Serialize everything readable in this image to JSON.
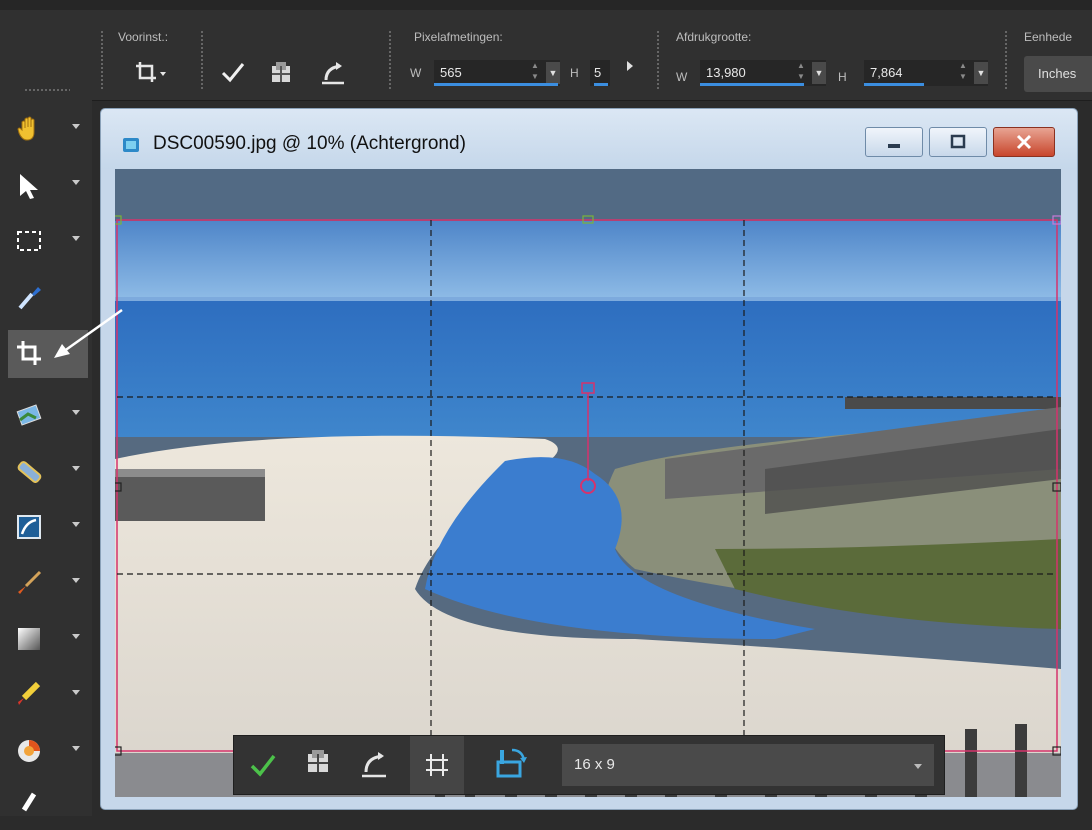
{
  "toolbar": {
    "presets_label": "Voorinst.:",
    "pixel_label": "Pixelafmetingen:",
    "pixel_w_label": "W",
    "pixel_w_value": "565",
    "pixel_h_label": "H",
    "pixel_h_value": "5",
    "print_label": "Afdrukgrootte:",
    "print_w_label": "W",
    "print_w_value": "13,980",
    "print_h_label": "H",
    "print_h_value": "7,864",
    "units_label": "Eenhede",
    "units_value": "Inches"
  },
  "palette": {
    "tools": [
      "pan-tool-icon",
      "pick-tool-icon",
      "selection-tool-icon",
      "dropper-tool-icon",
      "crop-tool-icon",
      "straighten-tool-icon",
      "red-eye-tool-icon",
      "makeover-tool-icon",
      "paint-brush-tool-icon",
      "gradient-tool-icon",
      "eraser-tool-icon",
      "picture-tube-tool-icon"
    ],
    "active_tool": "crop-tool-icon"
  },
  "window": {
    "title": "DSC00590.jpg @  10% (Achtergrond)"
  },
  "croptoolbar": {
    "ratio_value": "16 x 9"
  },
  "colors": {
    "accent": "#3b8ee0",
    "crop_border": "#d6336c",
    "check_green": "#4cc24a"
  }
}
